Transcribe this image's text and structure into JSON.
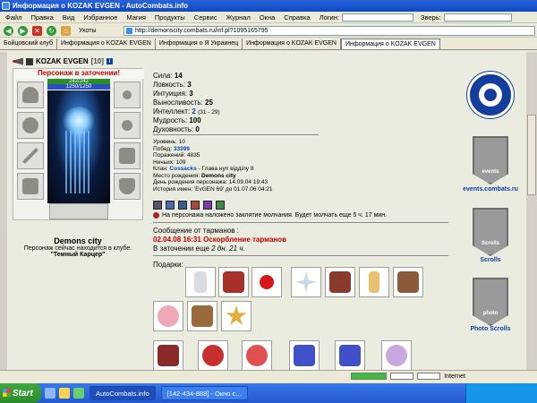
{
  "window": {
    "title": "Информация о KOZAK EVGEN - AutoCombats.info"
  },
  "menu": {
    "items": [
      "Файл",
      "Правка",
      "Вид",
      "Избранное",
      "Магия",
      "Продукты",
      "Сервис",
      "Журнал",
      "Окна",
      "Справка"
    ],
    "login_label": "Логин:",
    "beast_label": "Зверь:"
  },
  "nav": {
    "back": "◀",
    "forward": "▶",
    "stop": "✕",
    "refresh": "↻",
    "home": "⌂",
    "uhots": "Ухоты"
  },
  "address": {
    "url": "http://demonscity.combats.ru/inf.pl?1095165795"
  },
  "tabs": [
    "Бойцовский клуб",
    "Информация о KOZAK EVGEN",
    "Информация о Я Украинец",
    "Информация о KOZAK EVGEN",
    "Информация о KOZAK EVGEN"
  ],
  "character": {
    "name": "KOZAK EVGEN",
    "level": "[10]",
    "info_badge": "i",
    "prison_text": "Персонаж в заточении!",
    "hp": "242/242",
    "mp": "1250/1250",
    "city": "Demons city",
    "club_line": "Персонаж сейчас находится в клубе.",
    "club_room": "\"Темный Карцер\""
  },
  "stats": [
    {
      "label": "Сила:",
      "value": "14"
    },
    {
      "label": "Ловкость:",
      "value": "3"
    },
    {
      "label": "Интуиция:",
      "value": "3"
    },
    {
      "label": "Выносливость:",
      "value": "25"
    },
    {
      "label": "Интеллект:",
      "value": "2",
      "extra": "(31 - 29)"
    },
    {
      "label": "Мудрость:",
      "value": "100"
    },
    {
      "label": "Духовность:",
      "value": "0"
    }
  ],
  "info": {
    "level": "Уровень: 10",
    "wins_label": "Побед:",
    "wins": "33399",
    "losses": "Поражений: 4835",
    "draws": "Ничьих: 109",
    "clan_label": "Клан:",
    "clan": "Cossacks",
    "clan_role": " - Глава нуп відділу 8",
    "birthplace_label": "Место рождения:",
    "birthplace": "Demons city",
    "birthday": "День рождения персонажа: 14.09.04 19:43",
    "names_history": "История имен: 'EvGEN 69' до 01.07.06 04:21"
  },
  "curse": {
    "text": "На персонажа наложено заклятие молчания. Будет молчать еще 5 ч. 17 мин."
  },
  "messages": {
    "title": "Сообщение от тарманов :",
    "date": "02.04.08 16:31",
    "reason": "Оскорбление тарманов",
    "prison_line": "В заточении еще",
    "prison_time": "2 дн. 21 ч."
  },
  "gifts": {
    "label": "Подарки:"
  },
  "sidebar": {
    "events": "events.combats.ru",
    "scrolls": "Scrolls",
    "photo_scrolls": "Photo Scrolls",
    "banner1": "events",
    "banner2": "Scrolls",
    "banner3": "photo"
  },
  "status": {
    "text": "",
    "internet": "Internet"
  },
  "taskbar": {
    "start": "Start",
    "task1": "AutoCombats.info",
    "task2": "[142-434-888] - Окно с..."
  },
  "colors": {
    "prison_red": "#c00000",
    "link_blue": "#0b3ea8",
    "titlebar": "#0a46c8"
  }
}
